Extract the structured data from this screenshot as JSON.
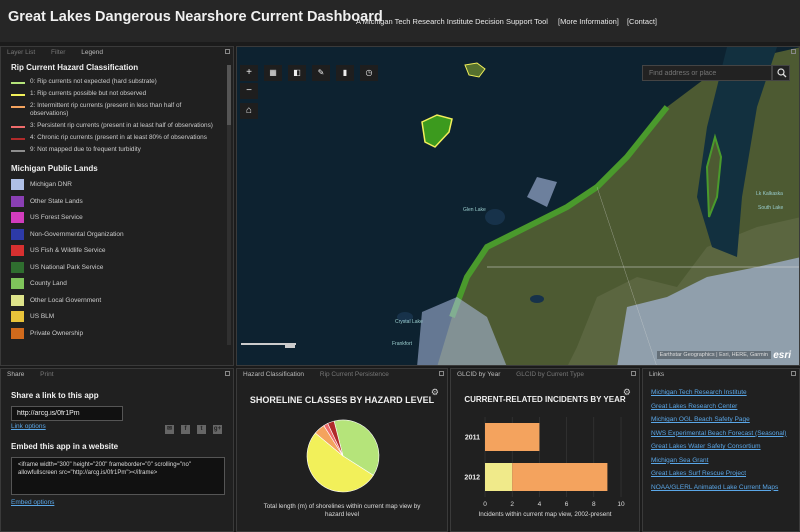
{
  "header": {
    "title": "Great Lakes Dangerous Nearshore Current Dashboard",
    "tagline": "A Michigan Tech Research Institute Decision Support Tool",
    "more_info": "[More Information]",
    "contact": "[Contact]"
  },
  "legend_panel": {
    "tabs": [
      "Layer List",
      "Filter",
      "Legend"
    ],
    "hazard_title": "Rip Current Hazard Classification",
    "hazard_items": [
      {
        "label": "0: Rip currents not expected (hard substrate)",
        "color": "#b5e47a"
      },
      {
        "label": "1: Rip currents possible but not observed",
        "color": "#f2f05a"
      },
      {
        "label": "2: Intermittent rip currents (present in less than half of observations)",
        "color": "#f4a35e"
      },
      {
        "label": "3: Persistent rip currents (present in at least half of observations)",
        "color": "#ee6b6b"
      },
      {
        "label": "4: Chronic rip currents (present in at least 80% of observations",
        "color": "#b02a2a"
      },
      {
        "label": "9: Not mapped due to frequent turbidity",
        "color": "#8d8d8d"
      }
    ],
    "lands_title": "Michigan Public Lands",
    "lands_items": [
      {
        "label": "Michigan DNR",
        "color": "#aebfe6"
      },
      {
        "label": "Other State Lands",
        "color": "#8a3fb4"
      },
      {
        "label": "US Forest Service",
        "color": "#d23cbd"
      },
      {
        "label": "Non-Governmental Organization",
        "color": "#2d3aa8"
      },
      {
        "label": "US Fish & Wildlife Service",
        "color": "#d73030"
      },
      {
        "label": "US National Park Service",
        "color": "#2f6e2f"
      },
      {
        "label": "County Land",
        "color": "#7fc45b"
      },
      {
        "label": "Other Local Government",
        "color": "#dde38a"
      },
      {
        "label": "US BLM",
        "color": "#e8c33a"
      },
      {
        "label": "Private Ownership",
        "color": "#d06a1c"
      }
    ]
  },
  "map": {
    "search_placeholder": "Find address or place",
    "attribution": "Earthstar Geographics | Esri, HERE, Garmin",
    "logo": "esri",
    "labels": [
      "Glen Lake",
      "Crystal Lake",
      "Frankfort",
      "Lk Kalkaska",
      "South Lake"
    ]
  },
  "share_panel": {
    "tabs": [
      "Share",
      "Print"
    ],
    "share_title": "Share a link to this app",
    "share_url": "http://arcg.is/0fr1Pm",
    "link_options": "Link options",
    "social": [
      "✉",
      "f",
      "t",
      "g+"
    ],
    "embed_title": "Embed this app in a website",
    "embed_code": "<iframe width=\"300\" height=\"200\" frameborder=\"0\" scrolling=\"no\" allowfullscreen src=\"http://arcg.is/0fr1Pm\"></iframe>",
    "embed_options": "Embed options"
  },
  "hazard_panel": {
    "tabs": [
      "Hazard Classification",
      "Rip Current Persistence"
    ],
    "title": "SHORELINE CLASSES BY HAZARD LEVEL",
    "caption": "Total length (m) of shorelines within current map view by hazard level"
  },
  "incidents_panel": {
    "tabs": [
      "GLCID by Year",
      "GLCID by Current Type"
    ],
    "title": "CURRENT-RELATED INCIDENTS BY YEAR",
    "caption": "Incidents within current map view, 2002-present"
  },
  "links_panel": {
    "tabs": [
      "Links"
    ],
    "items": [
      "Michigan Tech Research Institute",
      "Great Lakes Research Center",
      "Michigan OGL Beach Safety Page",
      "NWS Experimental Beach Forecast (Seasonal)",
      "Great Lakes Water Safety Consortium",
      "Michigan Sea Grant",
      "Great Lakes Surf Rescue Project",
      "NOAA/GLERL Animated Lake Current Maps"
    ]
  },
  "chart_data": [
    {
      "type": "pie",
      "title": "SHORELINE CLASSES BY HAZARD LEVEL",
      "slices": [
        {
          "value": 38,
          "color": "#b5e47a"
        },
        {
          "value": 52,
          "color": "#f2f05a"
        },
        {
          "value": 5,
          "color": "#f4a35e"
        },
        {
          "value": 2,
          "color": "#ee6b6b"
        },
        {
          "value": 3,
          "color": "#b02a2a"
        }
      ]
    },
    {
      "type": "bar",
      "orientation": "horizontal",
      "stacked": true,
      "title": "CURRENT-RELATED INCIDENTS BY YEAR",
      "xlabel": "Incidents within current map view, 2002-present",
      "categories": [
        "2011",
        "2012"
      ],
      "xlim": [
        0,
        10
      ],
      "xticks": [
        0,
        2,
        4,
        6,
        8,
        10
      ],
      "series": [
        {
          "values": [
            0,
            2
          ],
          "color": "#f0ea8a"
        },
        {
          "values": [
            4,
            7
          ],
          "color": "#f4a35e"
        }
      ]
    }
  ]
}
